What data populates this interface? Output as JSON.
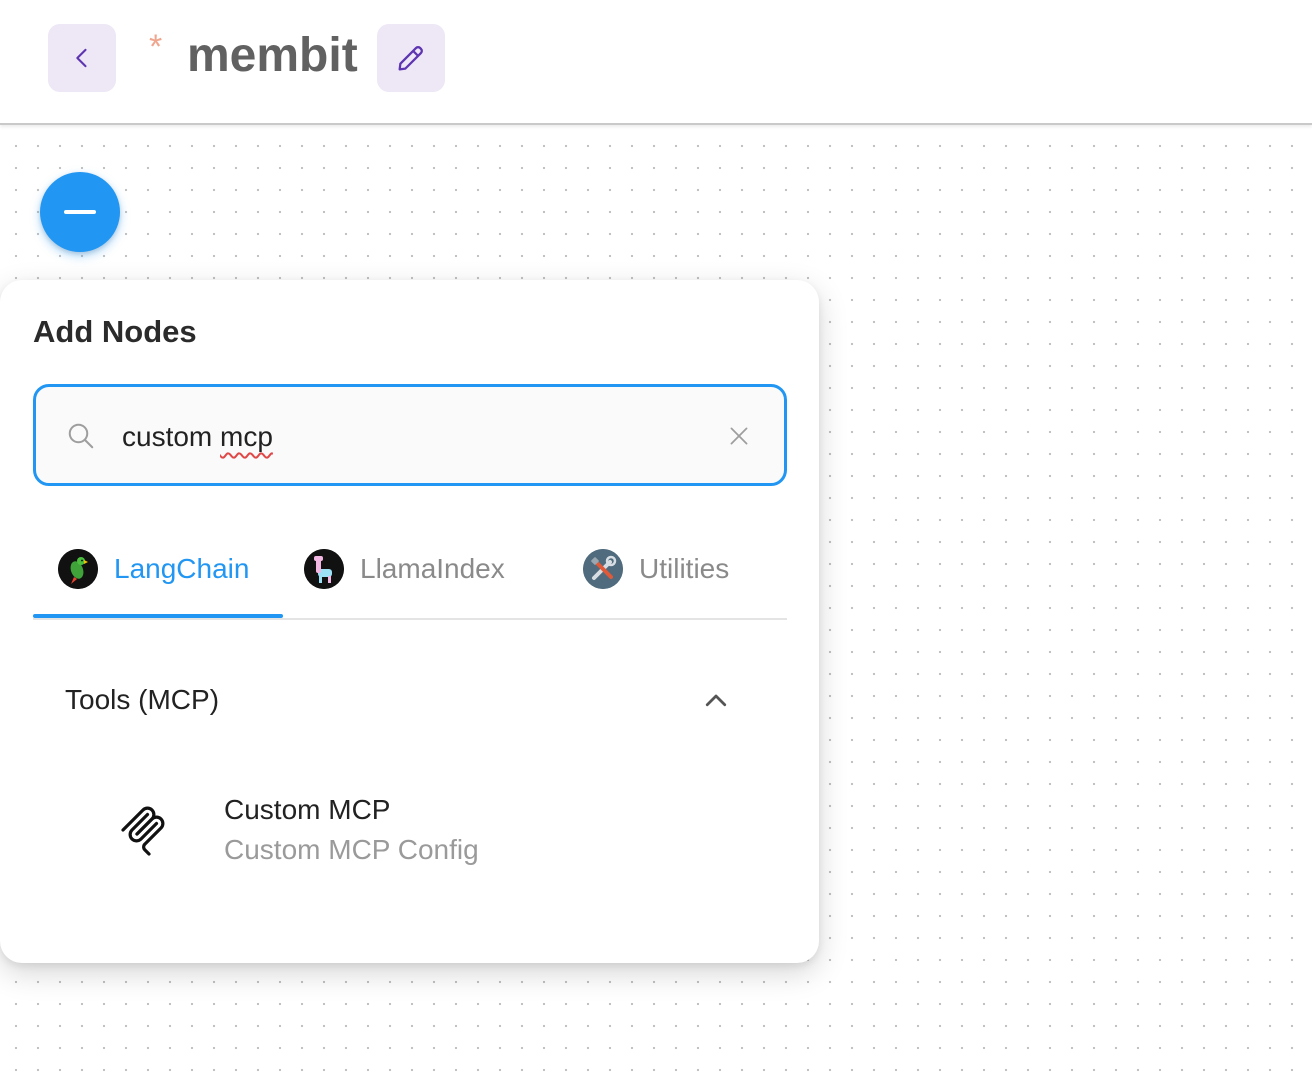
{
  "header": {
    "unsaved_marker": "*",
    "flow_name": "membit"
  },
  "panel": {
    "title": "Add Nodes",
    "search": {
      "value_plain": "custom ",
      "value_flagged": "mcp"
    },
    "tabs": [
      {
        "label": "LangChain",
        "icon": "parrot-icon",
        "active": true
      },
      {
        "label": "LlamaIndex",
        "icon": "llama-icon",
        "active": false
      },
      {
        "label": "Utilities",
        "icon": "tools-icon",
        "active": false
      }
    ],
    "section": {
      "title": "Tools (MCP)",
      "expanded": true
    },
    "nodes": [
      {
        "title": "Custom MCP",
        "description": "Custom MCP Config",
        "icon": "mcp-icon"
      }
    ]
  },
  "colors": {
    "accent": "#2196f3",
    "header_button_bg": "#ede7f6",
    "header_icon": "#5e35b1",
    "unsaved_marker": "#f0a58f"
  }
}
